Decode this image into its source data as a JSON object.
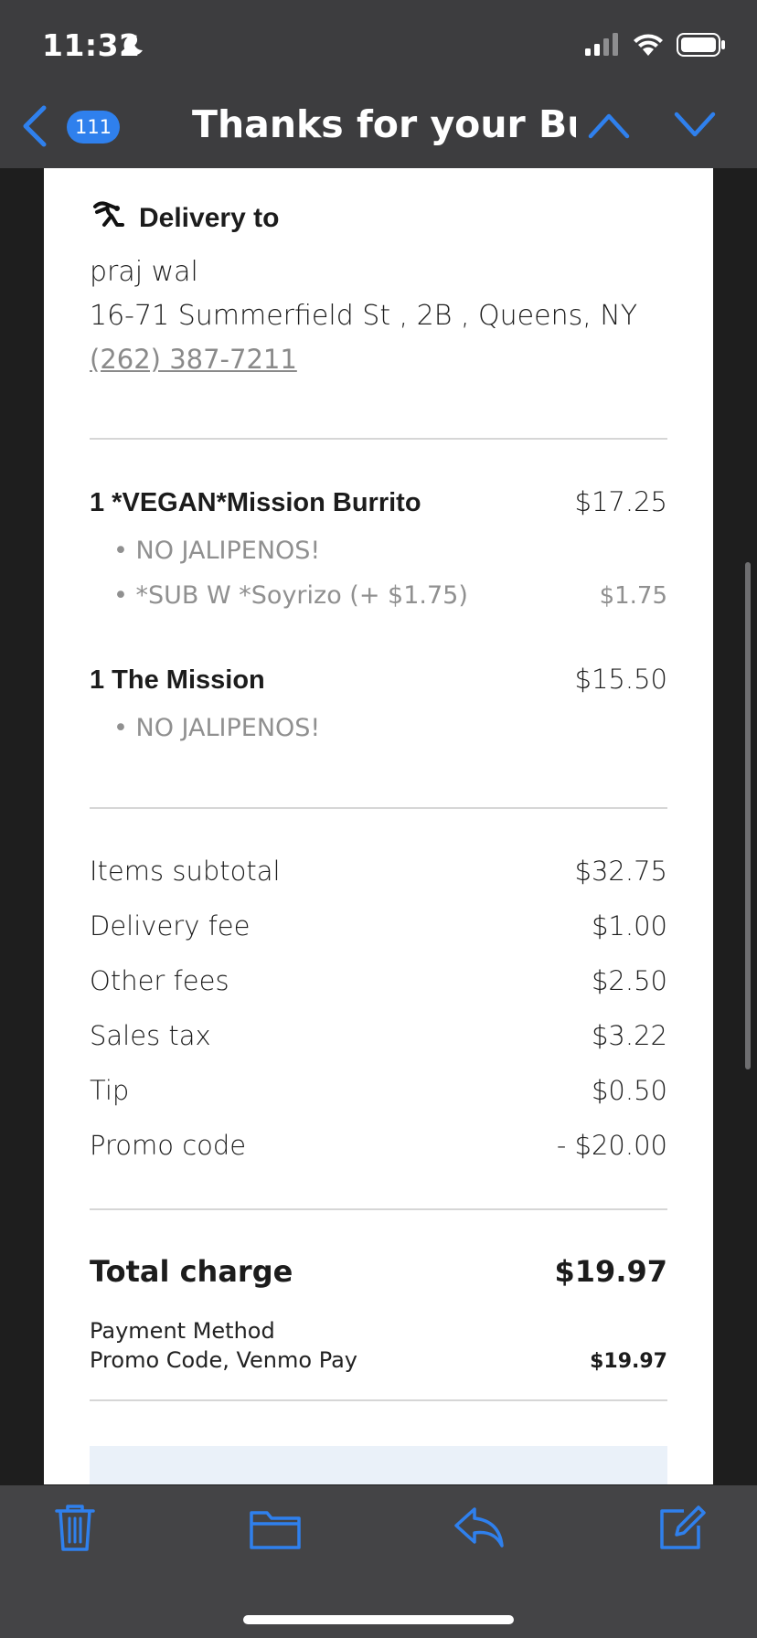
{
  "status": {
    "time": "11:32"
  },
  "nav": {
    "badge": "111",
    "title": "Thanks for your Bur..."
  },
  "delivery": {
    "label": "Delivery to",
    "name": "praj wal",
    "address": "16-71 Summerfield St , 2B , Queens, NY",
    "phone": "(262) 387-7211"
  },
  "items": [
    {
      "title": "1 *VEGAN*Mission Burrito",
      "price": "$17.25",
      "mods": [
        {
          "text": "• NO JALIPENOS!",
          "price": ""
        },
        {
          "text": "• *SUB W *Soyrizo (+ $1.75)",
          "price": "$1.75"
        }
      ]
    },
    {
      "title": "1 The Mission",
      "price": "$15.50",
      "mods": [
        {
          "text": "• NO JALIPENOS!",
          "price": ""
        }
      ]
    }
  ],
  "summary": [
    {
      "label": "Items subtotal",
      "value": "$32.75"
    },
    {
      "label": "Delivery fee",
      "value": "$1.00"
    },
    {
      "label": "Other fees",
      "value": "$2.50"
    },
    {
      "label": "Sales tax",
      "value": "$3.22"
    },
    {
      "label": "Tip",
      "value": "$0.50"
    },
    {
      "label": "Promo code",
      "value": "- $20.00"
    }
  ],
  "total": {
    "label": "Total charge",
    "value": "$19.97"
  },
  "payment": {
    "label": "Payment Method",
    "method": "Promo Code, Venmo Pay",
    "amount": "$19.97"
  },
  "colors": {
    "accent": "#2f80ed",
    "header_bg": "#3d3d3f",
    "toolbar_bg": "#444446"
  },
  "icons": [
    "moon-icon",
    "signal-icon",
    "wifi-icon",
    "battery-icon",
    "chevron-left-icon",
    "chevron-up-icon",
    "chevron-down-icon",
    "delivery-icon",
    "trash-icon",
    "folder-icon",
    "reply-icon",
    "compose-icon"
  ]
}
